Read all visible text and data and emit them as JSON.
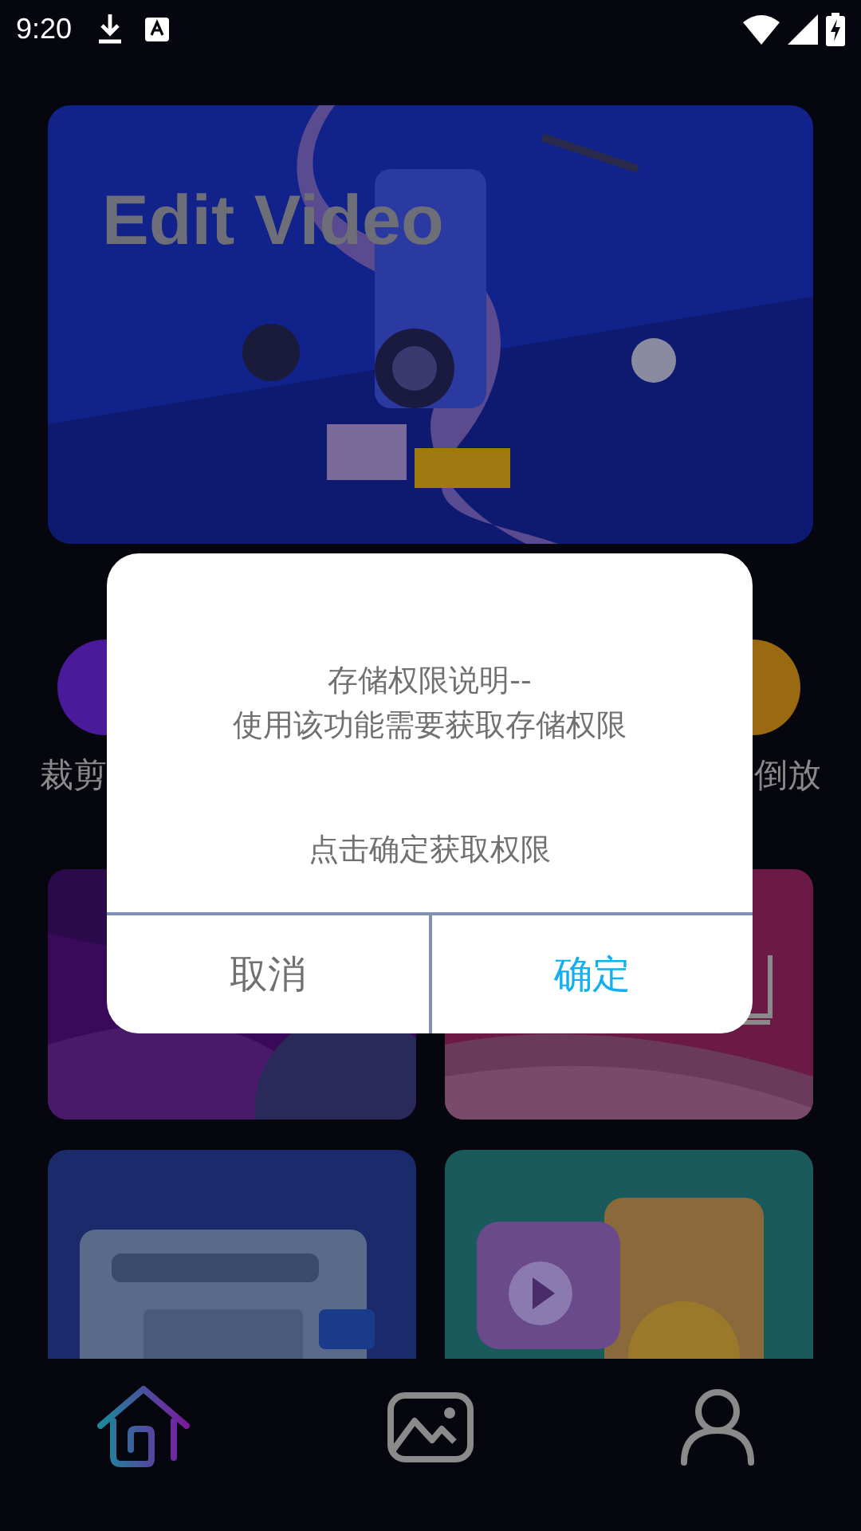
{
  "status_bar": {
    "time": "9:20"
  },
  "banner": {
    "title": "Edit Video",
    "kind": "picture"
  },
  "tools": [
    {
      "label": "裁剪",
      "color": "#4a1a9a"
    },
    {
      "label": "倒放",
      "color": "#9a6a10"
    }
  ],
  "dialog": {
    "message_lines": [
      "存储权限说明--",
      "使用该功能需要获取存储权限"
    ],
    "hint": "点击确定获取权限",
    "buttons": [
      {
        "label": "取消",
        "kind": "cancel"
      },
      {
        "label": "确定",
        "kind": "confirm"
      }
    ]
  },
  "nav": {
    "tabs": [
      {
        "selected": true
      },
      {
        "selected": false
      },
      {
        "selected": false
      }
    ]
  }
}
